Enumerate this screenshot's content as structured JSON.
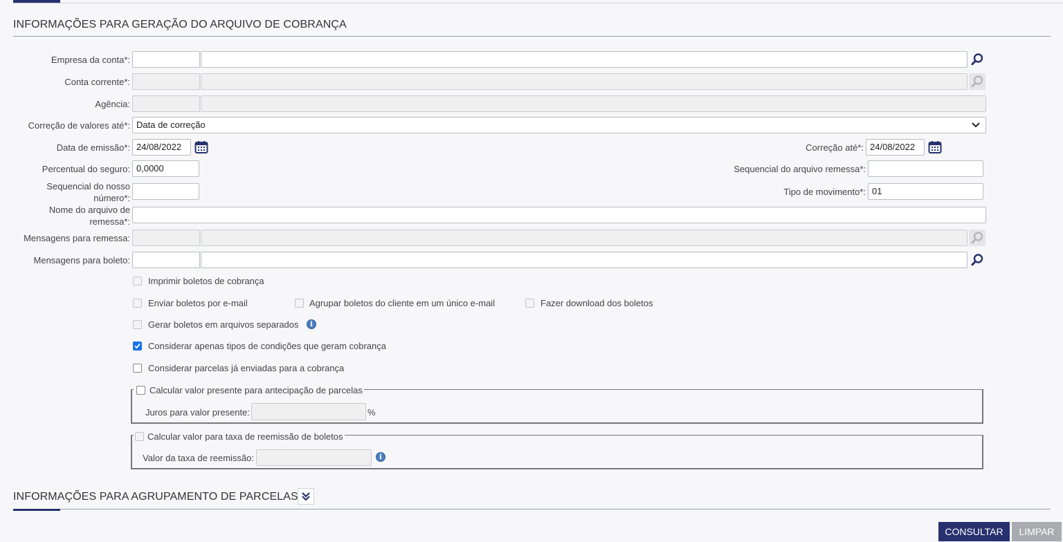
{
  "sections": {
    "cobranca_title": "INFORMAÇÕES PARA GERAÇÃO DO ARQUIVO DE COBRANÇA",
    "agrupamento_title": "INFORMAÇÕES PARA AGRUPAMENTO DE PARCELAS"
  },
  "form": {
    "empresa_label": "Empresa da conta*:",
    "empresa_code": "",
    "empresa_name": "",
    "conta_label": "Conta corrente*:",
    "agencia_label": "Agência:",
    "correcao_label": "Correção de valores até*:",
    "correcao_value": "Data de correção",
    "data_emissao_label": "Data de emissão*:",
    "data_emissao_value": "24/08/2022",
    "correcao_ate_label": "Correção até*:",
    "correcao_ate_value": "24/08/2022",
    "percentual_label": "Percentual do seguro:",
    "percentual_value": "0,0000",
    "seq_remessa_label": "Sequencial do arquivo remessa*:",
    "seq_remessa_value": "",
    "seq_nosso_label_1": "Sequencial do nosso",
    "seq_nosso_label_2": "número*:",
    "seq_nosso_value": "",
    "tipo_mov_label": "Tipo de movimento*:",
    "tipo_mov_value": "01",
    "nome_arquivo_label_1": "Nome do arquivo de",
    "nome_arquivo_label_2": "remessa*:",
    "nome_arquivo_value": "",
    "msg_remessa_label": "Mensagens para remessa:",
    "msg_boleto_label": "Mensagens para boleto:"
  },
  "options": {
    "imprimir": "Imprimir boletos de cobrança",
    "enviar_email": "Enviar boletos por e-mail",
    "agrupar": "Agrupar boletos do cliente em um único e-mail",
    "download": "Fazer download dos boletos",
    "separados": "Gerar boletos em arquivos separados",
    "considerar_tipos": "Considerar apenas tipos de condições que geram cobrança",
    "considerar_parcelas": "Considerar parcelas já enviadas para a cobrança"
  },
  "valor_presente": {
    "legend": "Calcular valor presente para antecipação de parcelas",
    "juros_label": "Juros para valor presente:",
    "juros_unit": "%"
  },
  "taxa_reemissao": {
    "legend": "Calcular valor para taxa de reemissão de boletos",
    "valor_label": "Valor da taxa de reemissão:"
  },
  "buttons": {
    "consultar": "CONSULTAR",
    "limpar": "LIMPAR"
  },
  "colors": {
    "primary": "#27316f",
    "checkbox_checked": "#1a73e8",
    "disabled_button": "#a9abb0"
  }
}
